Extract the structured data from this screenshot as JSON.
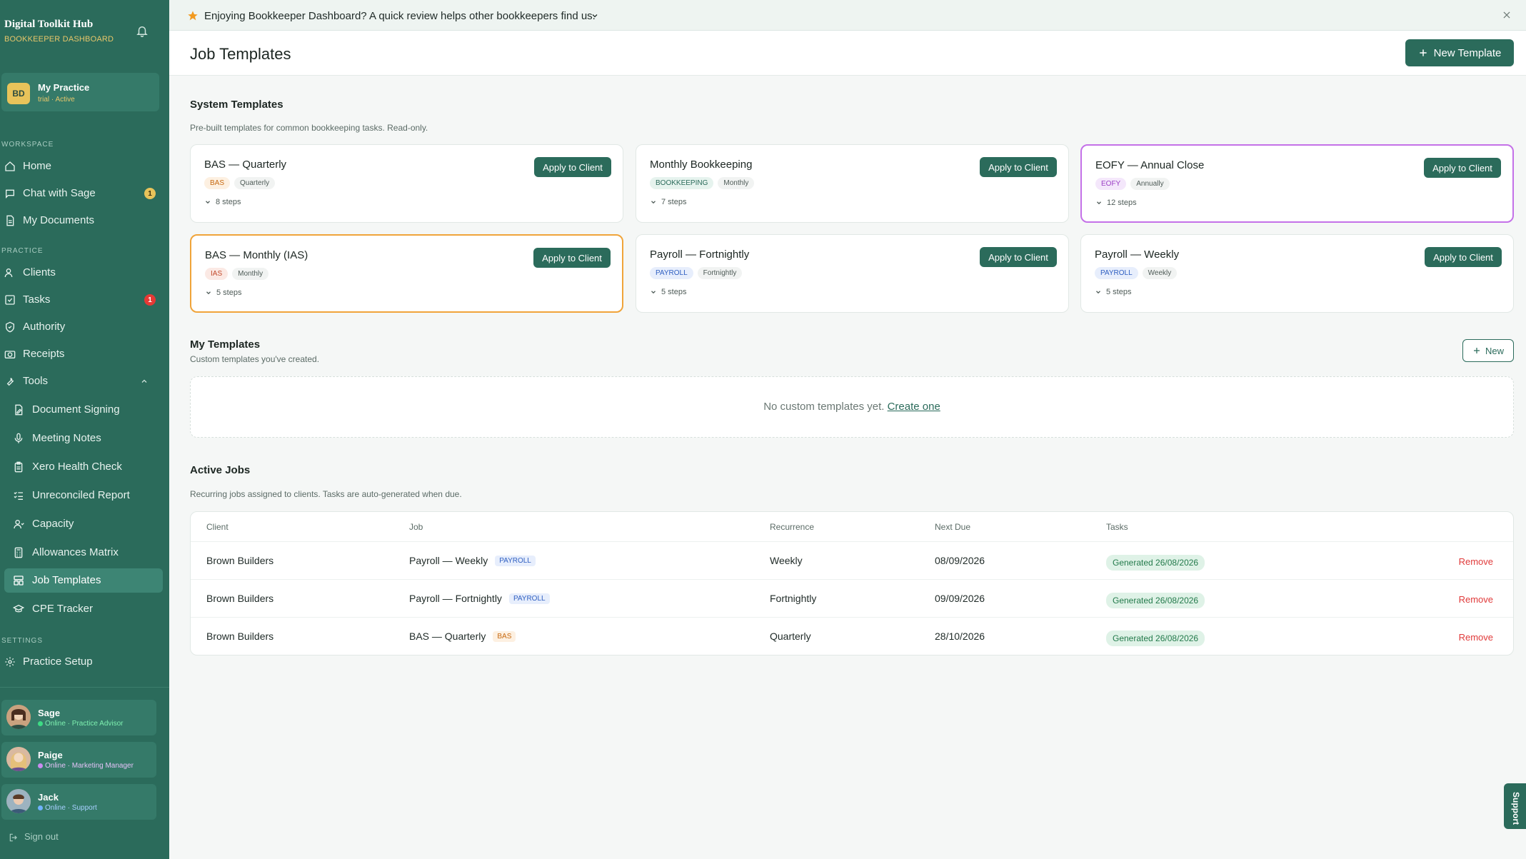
{
  "sidebar": {
    "brand_title": "Digital Toolkit Hub",
    "brand_subtitle": "BOOKKEEPER DASHBOARD",
    "practice": {
      "badge": "BD",
      "name": "My Practice",
      "status": "trial · Active"
    },
    "sections": {
      "workspace": "WORKSPACE",
      "practice": "PRACTICE",
      "settings": "SETTINGS"
    },
    "workspace_items": [
      {
        "label": "Home",
        "icon": "home-icon"
      },
      {
        "label": "Chat with Sage",
        "icon": "chat-icon",
        "badge": "1"
      },
      {
        "label": "My Documents",
        "icon": "document-icon"
      }
    ],
    "practice_items": [
      {
        "label": "Clients",
        "icon": "users-icon"
      },
      {
        "label": "Tasks",
        "icon": "checkbox-icon",
        "badge": "1"
      },
      {
        "label": "Authority",
        "icon": "shield-icon"
      },
      {
        "label": "Receipts",
        "icon": "camera-icon"
      },
      {
        "label": "Tools",
        "icon": "wrench-icon"
      }
    ],
    "tool_items": [
      {
        "label": "Document Signing",
        "icon": "signature-icon"
      },
      {
        "label": "Meeting Notes",
        "icon": "microphone-icon"
      },
      {
        "label": "Xero Health Check",
        "icon": "clipboard-icon"
      },
      {
        "label": "Unreconciled Report",
        "icon": "list-check-icon"
      },
      {
        "label": "Capacity",
        "icon": "user-capacity-icon"
      },
      {
        "label": "Allowances Matrix",
        "icon": "calculator-icon"
      },
      {
        "label": "Job Templates",
        "icon": "template-icon"
      },
      {
        "label": "CPE Tracker",
        "icon": "graduation-cap-icon"
      }
    ],
    "settings_items": [
      {
        "label": "Practice Setup",
        "icon": "gear-icon"
      }
    ],
    "agents": [
      {
        "name": "Sage",
        "status": "Online · Practice Advisor",
        "dot_color": "#3ddc84",
        "status_color": "#7ef0b0"
      },
      {
        "name": "Paige",
        "status": "Online · Marketing Manager",
        "dot_color": "#c98cf0",
        "status_color": "#e3c2f7"
      },
      {
        "name": "Jack",
        "status": "Online · Support",
        "dot_color": "#6fb2ff",
        "status_color": "#a8d0ff"
      }
    ],
    "sign_out": "Sign out"
  },
  "banner": {
    "text": "Enjoying Bookkeeper Dashboard? A quick review helps other bookkeepers find us."
  },
  "header": {
    "title": "Job Templates",
    "new_template_label": "New Template"
  },
  "system_templates": {
    "title": "System Templates",
    "description": "Pre-built templates for common bookkeeping tasks. Read-only.",
    "apply_label": "Apply to Client",
    "cards": [
      {
        "name": "BAS — Quarterly",
        "tag": "BAS",
        "frequency": "Quarterly",
        "steps": "8 steps"
      },
      {
        "name": "Monthly Bookkeeping",
        "tag": "BOOKKEEPING",
        "frequency": "Monthly",
        "steps": "7 steps"
      },
      {
        "name": "EOFY — Annual Close",
        "tag": "EOFY",
        "frequency": "Annually",
        "steps": "12 steps"
      },
      {
        "name": "BAS — Monthly (IAS)",
        "tag": "IAS",
        "frequency": "Monthly",
        "steps": "5 steps"
      },
      {
        "name": "Payroll — Fortnightly",
        "tag": "PAYROLL",
        "frequency": "Fortnightly",
        "steps": "5 steps"
      },
      {
        "name": "Payroll — Weekly",
        "tag": "PAYROLL",
        "frequency": "Weekly",
        "steps": "5 steps"
      }
    ]
  },
  "my_templates": {
    "title": "My Templates",
    "description": "Custom templates you've created.",
    "new_label": "New",
    "empty_text": "No custom templates yet.",
    "create_link": "Create one"
  },
  "active_jobs": {
    "title": "Active Jobs",
    "description": "Recurring jobs assigned to clients. Tasks are auto-generated when due.",
    "columns": [
      "Client",
      "Job",
      "Recurrence",
      "Next Due",
      "Tasks"
    ],
    "remove_label": "Remove",
    "rows": [
      {
        "client": "Brown Builders",
        "job": "Payroll — Weekly",
        "tag": "PAYROLL",
        "recurrence": "Weekly",
        "next_due": "08/09/2026",
        "tasks": "Generated 26/08/2026"
      },
      {
        "client": "Brown Builders",
        "job": "Payroll — Fortnightly",
        "tag": "PAYROLL",
        "recurrence": "Fortnightly",
        "next_due": "09/09/2026",
        "tasks": "Generated 26/08/2026"
      },
      {
        "client": "Brown Builders",
        "job": "BAS — Quarterly",
        "tag": "BAS",
        "recurrence": "Quarterly",
        "next_due": "28/10/2026",
        "tasks": "Generated 26/08/2026"
      }
    ]
  },
  "support_tab": "Support",
  "colors": {
    "sidebar_bg": "#2b6b5b",
    "accent_gold": "#e8c76a",
    "remove_red": "#e03a3a"
  }
}
